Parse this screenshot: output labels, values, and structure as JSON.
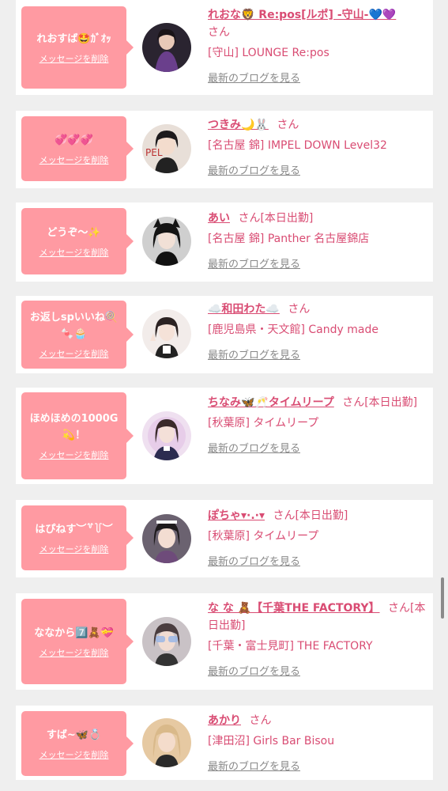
{
  "entries": [
    {
      "message": "れおすば🤩ｶﾞｵｯ",
      "delete_label": "メッセージを削除",
      "name": "れおな🦁 Re:pos[ルポ] -守山-💙💜",
      "suffix": "さん",
      "shop": "[守山] LOUNGE Re:pos",
      "blog_link": "最新のブログを見る"
    },
    {
      "message": "💞💞💞",
      "delete_label": "メッセージを削除",
      "name": "つきみ🌙🐰",
      "suffix": "さん",
      "shop": "[名古屋 錦] IMPEL DOWN Level32",
      "blog_link": "最新のブログを見る"
    },
    {
      "message": "どうぞ〜✨",
      "delete_label": "メッセージを削除",
      "name": "あい",
      "suffix": "さん[本日出勤]",
      "shop": "[名古屋 錦] Panther 名古屋錦店",
      "blog_link": "最新のブログを見る"
    },
    {
      "message": "お返しspいいね🍭🍬🧁",
      "delete_label": "メッセージを削除",
      "name": "☁️和田わた☁️",
      "suffix": "さん",
      "shop": "[鹿児島県・天文館] Candy made",
      "blog_link": "最新のブログを見る"
    },
    {
      "message": "ほめほめの1000G💫！",
      "delete_label": "メッセージを削除",
      "name": "ちなみ🦋🥂タイムリープ",
      "suffix": "さん[本日出勤]",
      "shop": "[秋葉原] タイムリープ",
      "blog_link": "最新のブログを見る"
    },
    {
      "message": "はぴねす︶꒷꒦︶",
      "delete_label": "メッセージを削除",
      "name": "ぽちゃ▾·.·▾",
      "suffix": "さん[本日出勤]",
      "shop": "[秋葉原] タイムリープ",
      "blog_link": "最新のブログを見る"
    },
    {
      "message": "ななから7️⃣🧸💝",
      "delete_label": "メッセージを削除",
      "name": "な な 🧸【千葉THE FACTORY】",
      "suffix": "さん[本日出勤]",
      "shop": "[千葉・富士見町] THE FACTORY",
      "blog_link": "最新のブログを見る"
    },
    {
      "message": "すば~🦋💍",
      "delete_label": "メッセージを削除",
      "name": "あかり",
      "suffix": "さん",
      "shop": "[津田沼] Girls Bar Bisou",
      "blog_link": "最新のブログを見る"
    }
  ],
  "colors": {
    "bubble": "#ff9aa2",
    "name": "#d94c73",
    "background": "#efefef"
  }
}
